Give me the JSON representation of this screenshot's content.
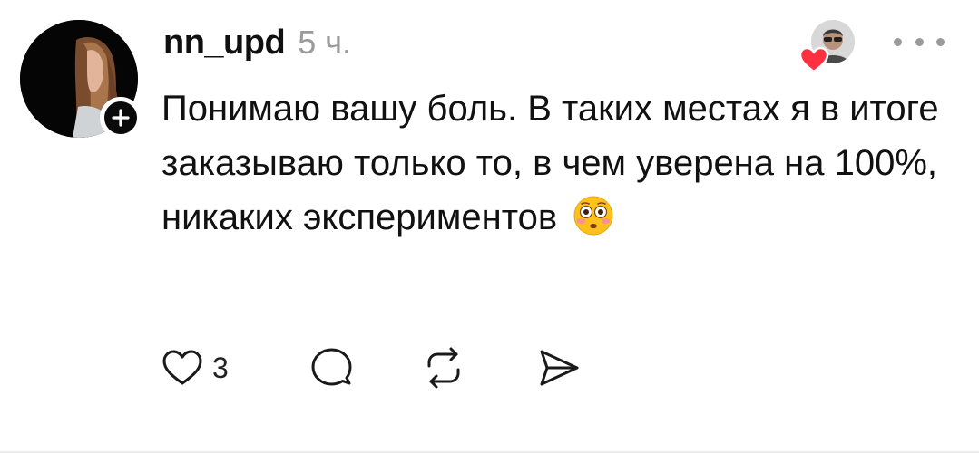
{
  "post": {
    "username": "nn_upd",
    "timestamp": "5 ч.",
    "body_text": "Понимаю вашу боль. В таких местах я в итоге заказываю только то, в чем уверена на 100%, никаких экспериментов",
    "emoji": "flushed-face-emoji",
    "like_count": "3"
  },
  "icons": {
    "follow": "plus-icon",
    "liker_heart": "heart-icon",
    "more": "more-horizontal-icon",
    "like": "heart-outline-icon",
    "reply": "comment-icon",
    "repost": "repost-icon",
    "share": "send-icon"
  },
  "colors": {
    "text": "#111111",
    "muted": "#9a9a9a",
    "heart": "#ff3040",
    "badge": "#0a0a0a",
    "icon_stroke": "#1a1a1a"
  }
}
